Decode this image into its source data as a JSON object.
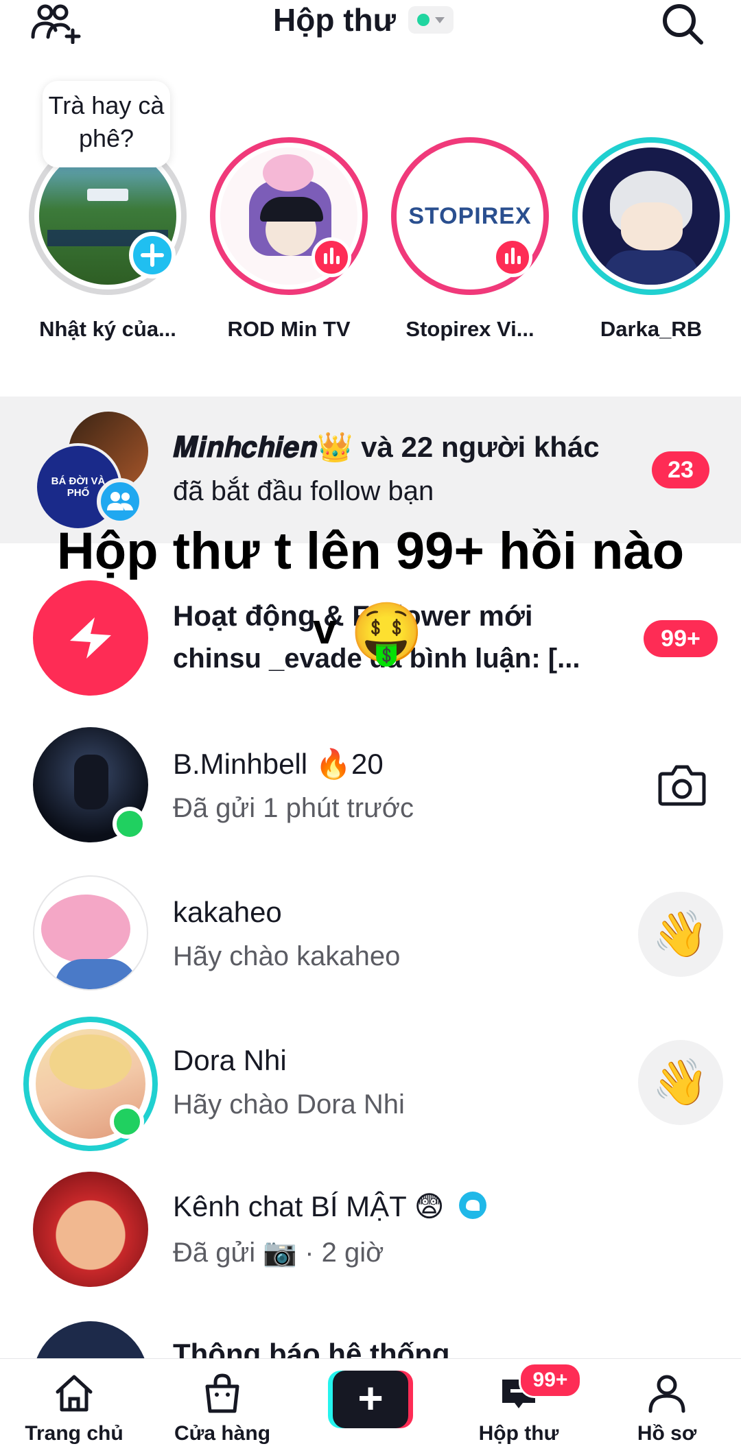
{
  "header": {
    "title": "Hộp thư",
    "status_color": "#20d5a0"
  },
  "stories": [
    {
      "name": "Nhật ký của...",
      "bubble": "Trà hay cà phê?",
      "badge": "add"
    },
    {
      "name": "ROD Min TV",
      "badge": "live"
    },
    {
      "name": "Stopirex Vi...",
      "avatar_text": "STOPIREX",
      "badge": "live"
    },
    {
      "name": "Darka_RB",
      "badge": "none"
    }
  ],
  "followers_row": {
    "title_name": "𝑴𝒊𝒏𝒉𝒄𝒉𝒊𝒆𝒏👑",
    "title_rest": " và 22 người khác",
    "subtitle": "đã bắt đầu follow bạn",
    "count": "23",
    "avatar_text": "BÁ ĐỜI VÀ PHỐ"
  },
  "overlay": {
    "caption": "Hộp thư t lên 99+ hồi nào",
    "caption2": "v",
    "emoji": "🤑"
  },
  "activity_row": {
    "title": "Hoạt động & Follower mới",
    "subtitle": "chinsu _evade đã bình luận: [...",
    "count": "99+"
  },
  "chats": [
    {
      "name": "B.Minhbell 🔥20",
      "message": "Đã gửi 1 phút trước",
      "action": "camera"
    },
    {
      "name": "kakaheo",
      "message": "Hãy chào kakaheo",
      "action": "wave",
      "emoji": "👋"
    },
    {
      "name": "Dora Nhi",
      "message": "Hãy chào Dora Nhi",
      "action": "wave",
      "emoji": "👋"
    },
    {
      "name": "Kênh chat BÍ MẬT 😨",
      "message": "Đã gửi 📷  · 2 giờ",
      "action": "none"
    },
    {
      "name": "Thông báo hệ thống",
      "message": "",
      "action": "none"
    }
  ],
  "bottom_nav": {
    "home": "Trang chủ",
    "shop": "Cửa hàng",
    "create": "+",
    "inbox": "Hộp thư",
    "inbox_badge": "99+",
    "profile": "Hồ sơ"
  },
  "colors": {
    "accent": "#fe2c55",
    "cyan": "#25f4ee",
    "online": "#20d060"
  }
}
